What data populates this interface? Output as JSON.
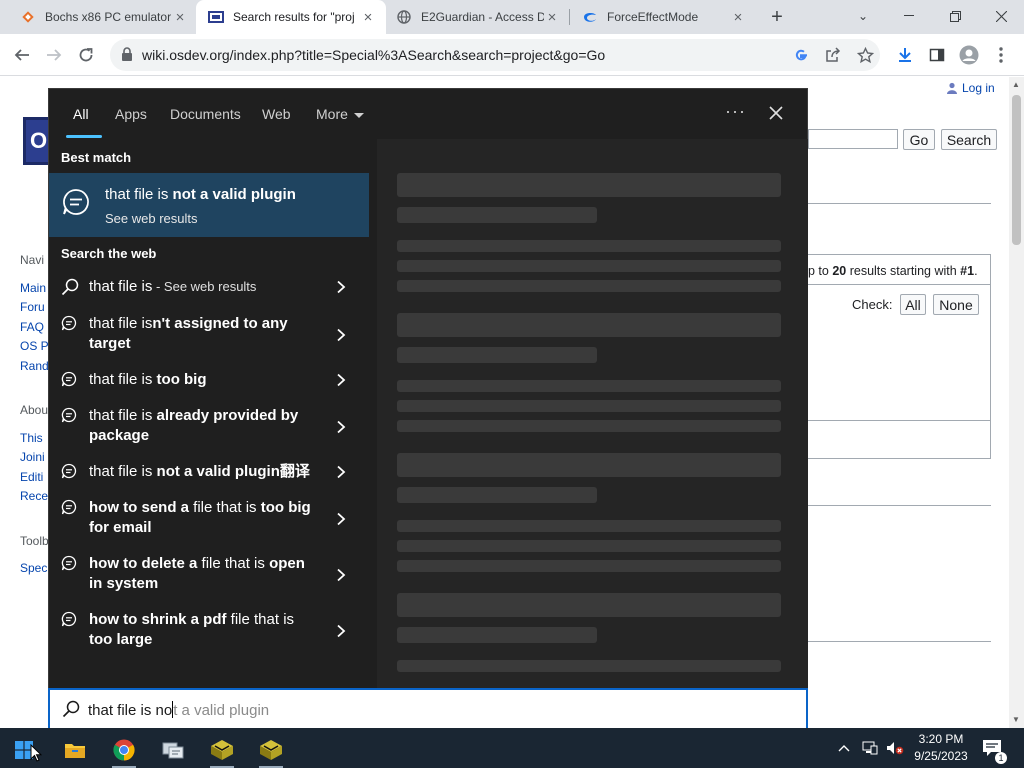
{
  "browser": {
    "tabs": [
      {
        "title": "Bochs x86 PC emulator",
        "icon": "bochs-diamond-icon"
      },
      {
        "title": "Search results for \"proj",
        "icon": "osdev-favicon-icon",
        "active": true
      },
      {
        "title": "E2Guardian - Access D",
        "icon": "globe-icon"
      },
      {
        "title": "ForceEffectMode",
        "icon": "blue-swirl-icon"
      }
    ],
    "url": "wiki.osdev.org/index.php?title=Special%3ASearch&search=project&go=Go"
  },
  "page": {
    "login": "Log in",
    "search_buttons": {
      "go": "Go",
      "search": "Search"
    },
    "sidebar": {
      "nav_heading": "Navi",
      "nav_links": [
        "Main",
        "Foru",
        "FAQ",
        "OS P",
        "Rand"
      ],
      "about_heading": "Abou",
      "about_links": [
        "This",
        "Joini",
        "Editi",
        "Rece"
      ],
      "tools_heading": "Toolb",
      "tools_links": [
        "Spec"
      ]
    },
    "results_info": {
      "prefix": "p to ",
      "count": "20",
      "middle": " results starting with ",
      "start": "#1",
      "suffix": "."
    },
    "check": {
      "label": "Check:",
      "all": "All",
      "none": "None"
    }
  },
  "search_panel": {
    "tabs": [
      "All",
      "Apps",
      "Documents",
      "Web",
      "More"
    ],
    "best_match_heading": "Best match",
    "best_match": {
      "prefix": "that file is ",
      "bold": "not a valid plugin",
      "subtitle": "See web results"
    },
    "web_heading": "Search the web",
    "suggestions": [
      {
        "icon": "search-icon",
        "normal": "that file is",
        "bold": "",
        "muted": " - See web results"
      },
      {
        "icon": "web-suggestion-icon",
        "normal": "that file is",
        "bold": "n't assigned to any target"
      },
      {
        "icon": "web-suggestion-icon",
        "normal": "that file is ",
        "bold": "too big"
      },
      {
        "icon": "web-suggestion-icon",
        "normal": "that file is ",
        "bold": "already provided by package"
      },
      {
        "icon": "web-suggestion-icon",
        "normal": "that file is ",
        "bold": "not a valid plugin翻译"
      },
      {
        "icon": "web-suggestion-icon",
        "segments": [
          [
            "b",
            "how to send a"
          ],
          [
            "n",
            " file that is "
          ],
          [
            "b",
            "too big for email"
          ]
        ]
      },
      {
        "icon": "web-suggestion-icon",
        "segments": [
          [
            "b",
            "how to delete a"
          ],
          [
            "n",
            " file that is "
          ],
          [
            "b",
            "open in system"
          ]
        ]
      },
      {
        "icon": "web-suggestion-icon",
        "segments": [
          [
            "b",
            "how to shrink a pdf"
          ],
          [
            "n",
            " file that is "
          ],
          [
            "b",
            "too large"
          ]
        ]
      }
    ],
    "query_typed": "that file is no",
    "query_ghost": "t a valid plugin"
  },
  "taskbar": {
    "apps": [
      "start-windows-icon",
      "file-explorer-icon",
      "chrome-icon",
      "network-app-icon",
      "bochs-icon",
      "bochs-icon-2"
    ],
    "time": "3:20 PM",
    "date": "9/25/2023",
    "notification_count": "1"
  },
  "colors": {
    "accent": "#4cc2ff",
    "best_match_bg": "#1f4460",
    "panel_bg": "#1f1f1f",
    "taskbar_bg": "#1a2633"
  }
}
